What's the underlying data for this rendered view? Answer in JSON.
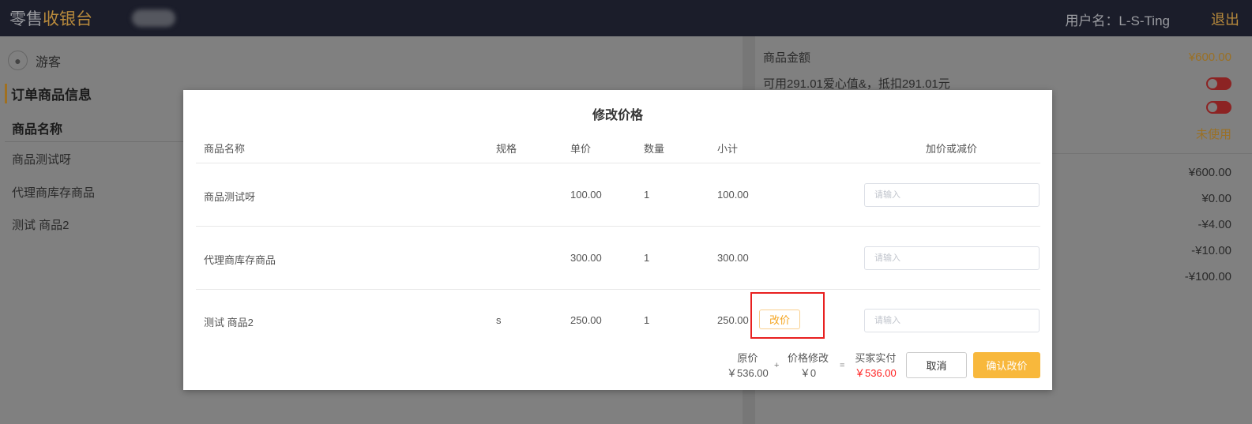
{
  "header": {
    "logo_a": "零售",
    "logo_b": "收银台",
    "user": "用户名：L-S-Ting",
    "logout": "退出"
  },
  "left": {
    "guest": "游客",
    "section": "订单商品信息",
    "col": "商品名称",
    "items": [
      "商品测试呀",
      "代理商库存商品",
      "测试 商品2"
    ]
  },
  "right": {
    "amount_label": "商品金额",
    "amount": "¥600.00",
    "love": "可用291.01爱心值&，抵扣291.01元",
    "unused": "未使用",
    "values": [
      "¥600.00",
      "¥0.00",
      "-¥4.00",
      "-¥10.00",
      "-¥100.00"
    ]
  },
  "modal": {
    "title": "修改价格",
    "cols": [
      "商品名称",
      "规格",
      "单价",
      "数量",
      "小计",
      "加价或减价"
    ],
    "rows": [
      {
        "name": "商品测试呀",
        "spec": "",
        "price": "100.00",
        "qty": "1",
        "sub": "100.00"
      },
      {
        "name": "代理商库存商品",
        "spec": "",
        "price": "300.00",
        "qty": "1",
        "sub": "300.00"
      },
      {
        "name": "测试 商品2",
        "spec": "s",
        "price": "250.00",
        "qty": "1",
        "sub": "250.00"
      }
    ],
    "placeholder": "请输入",
    "change_btn": "改价",
    "orig_label": "原价",
    "orig": "￥536.00",
    "plus": "+",
    "mod_label": "价格修改",
    "mod": "￥0",
    "eq": "=",
    "pay_label": "买家实付",
    "pay": "￥536.00",
    "cancel": "取消",
    "confirm": "确认改价"
  }
}
